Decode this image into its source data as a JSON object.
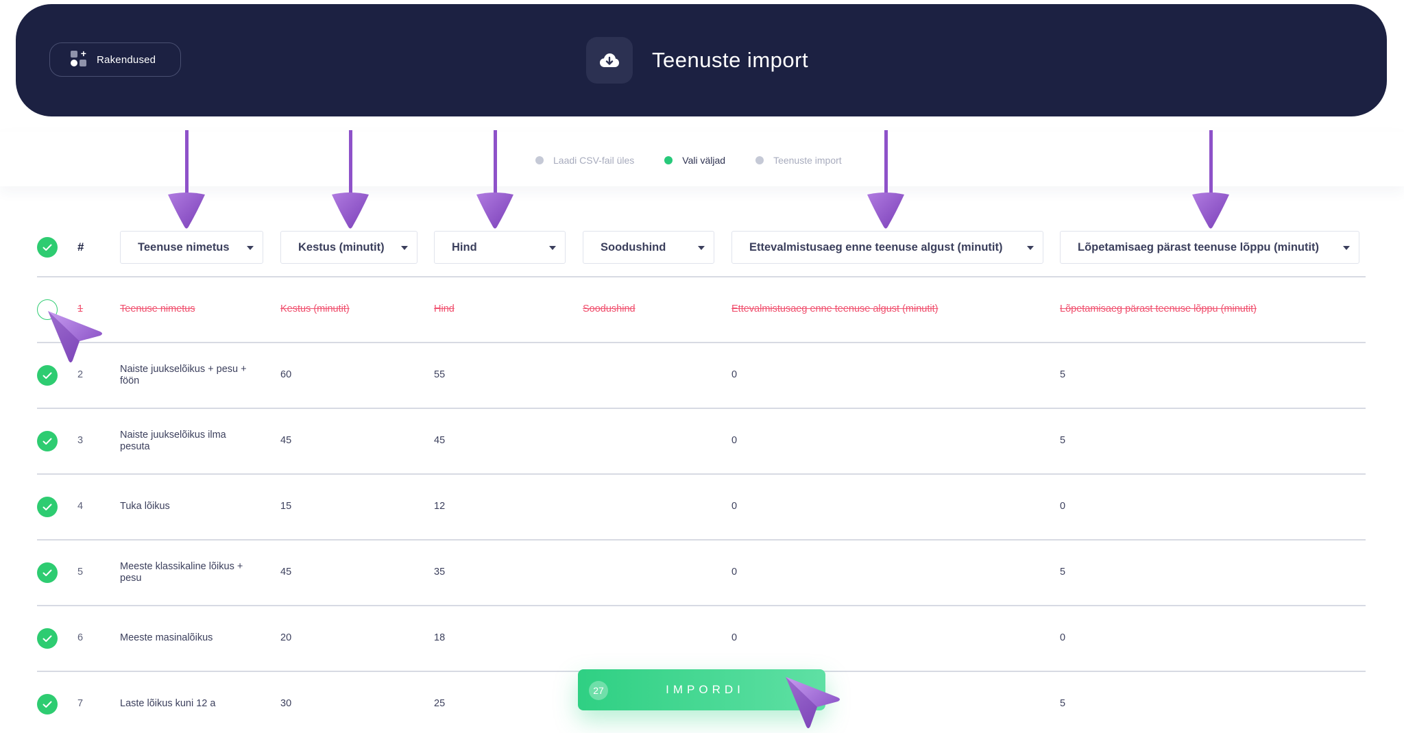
{
  "header": {
    "apps_label": "Rakendused",
    "title": "Teenuste import"
  },
  "stepper": {
    "steps": [
      {
        "label": "Laadi CSV-fail üles",
        "state": "inactive"
      },
      {
        "label": "Vali väljad",
        "state": "active"
      },
      {
        "label": "Teenuste import",
        "state": "inactive"
      }
    ]
  },
  "table": {
    "hash": "#",
    "columns": [
      "Teenuse nimetus",
      "Kestus (minutit)",
      "Hind",
      "Soodushind",
      "Ettevalmistusaeg enne teenuse algust (minutit)",
      "Lõpetamisaeg pärast teenuse lõppu (minutit)"
    ],
    "excluded_row": {
      "index": "1",
      "cells": [
        "Teenuse nimetus",
        "Kestus (minutit)",
        "Hind",
        "Soodushind",
        "Ettevalmistusaeg enne teenuse algust (minutit)",
        "Lõpetamisaeg pärast teenuse lõppu (minutit)"
      ]
    },
    "rows": [
      {
        "index": "2",
        "name": "Naiste juukselõikus + pesu + föön",
        "duration": "60",
        "price": "55",
        "discount": "",
        "prep": "0",
        "finish": "5"
      },
      {
        "index": "3",
        "name": "Naiste juukselõikus ilma pesuta",
        "duration": "45",
        "price": "45",
        "discount": "",
        "prep": "0",
        "finish": "5"
      },
      {
        "index": "4",
        "name": "Tuka lõikus",
        "duration": "15",
        "price": "12",
        "discount": "",
        "prep": "0",
        "finish": "0"
      },
      {
        "index": "5",
        "name": "Meeste klassikaline lõikus + pesu",
        "duration": "45",
        "price": "35",
        "discount": "",
        "prep": "0",
        "finish": "5"
      },
      {
        "index": "6",
        "name": "Meeste masinalõikus",
        "duration": "20",
        "price": "18",
        "discount": "",
        "prep": "0",
        "finish": "0"
      },
      {
        "index": "7",
        "name": "Laste lõikus kuni 12 a",
        "duration": "30",
        "price": "25",
        "discount": "",
        "prep": "",
        "finish": "5"
      }
    ]
  },
  "import_button": {
    "count": "27",
    "label": "IMPORDI"
  },
  "colors": {
    "header_bg": "#1c2142",
    "accent_green": "#2ecc71",
    "strike_red": "#f0506e",
    "annotation_purple": "#8e52c9"
  }
}
